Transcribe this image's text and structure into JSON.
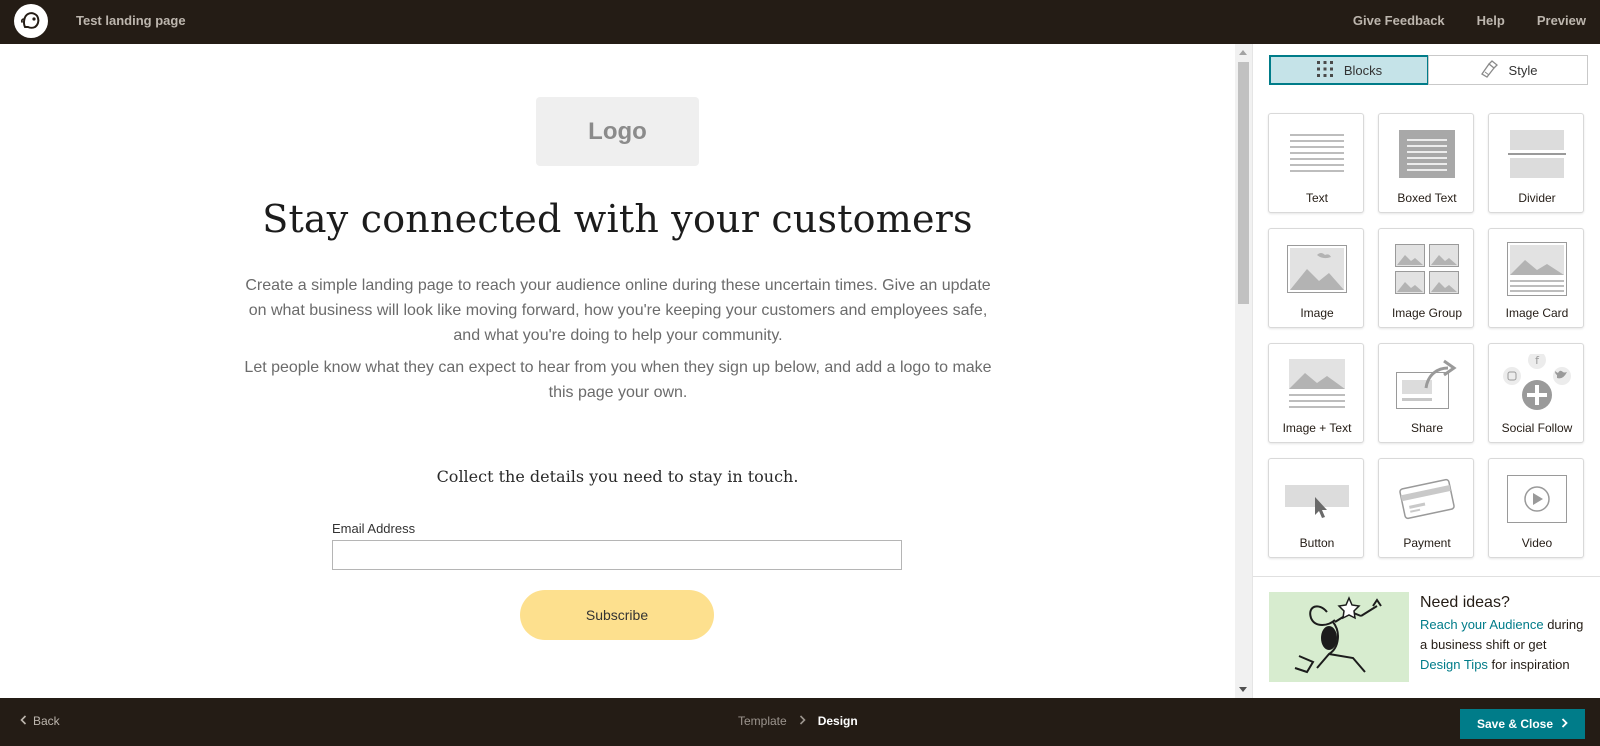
{
  "topbar": {
    "page_name": "Test landing page",
    "links": [
      "Give Feedback",
      "Help",
      "Preview"
    ]
  },
  "canvas": {
    "logo_placeholder": "Logo",
    "headline": "Stay connected with your customers",
    "paragraph_1": "Create a simple landing page to reach your audience online during these uncertain times. Give an update on what business will look like moving forward, how you're keeping your customers and employees safe, and what you're doing to help your community.",
    "paragraph_2": "Let people know what they can expect to hear from you when they sign up below, and add a logo to make this page your own.",
    "collect_text": "Collect the details you need to stay in touch.",
    "email_label": "Email Address",
    "email_value": "",
    "subscribe_label": "Subscribe",
    "subscribe_color": "#fde08e"
  },
  "panel": {
    "tabs": [
      {
        "label": "Blocks",
        "icon": "grid-dots-icon",
        "active": true
      },
      {
        "label": "Style",
        "icon": "paint-brush-icon",
        "active": false
      }
    ],
    "blocks": [
      {
        "label": "Text",
        "icon": "text-block-icon"
      },
      {
        "label": "Boxed Text",
        "icon": "boxed-text-icon"
      },
      {
        "label": "Divider",
        "icon": "divider-icon"
      },
      {
        "label": "Image",
        "icon": "image-icon"
      },
      {
        "label": "Image Group",
        "icon": "image-group-icon"
      },
      {
        "label": "Image Card",
        "icon": "image-card-icon"
      },
      {
        "label": "Image + Text",
        "icon": "image-text-icon"
      },
      {
        "label": "Share",
        "icon": "share-icon"
      },
      {
        "label": "Social Follow",
        "icon": "social-follow-icon"
      },
      {
        "label": "Button",
        "icon": "button-icon"
      },
      {
        "label": "Payment",
        "icon": "payment-icon"
      },
      {
        "label": "Video",
        "icon": "video-icon"
      }
    ],
    "ideas": {
      "title": "Need ideas?",
      "link_1": "Reach your Audience",
      "text_1": " during a business shift or get ",
      "link_2": "Design Tips",
      "text_2": " for inspiration"
    }
  },
  "bottombar": {
    "back_label": "Back",
    "crumb_template": "Template",
    "crumb_design": "Design",
    "save_label": "Save & Close",
    "accent": "#007c89"
  }
}
